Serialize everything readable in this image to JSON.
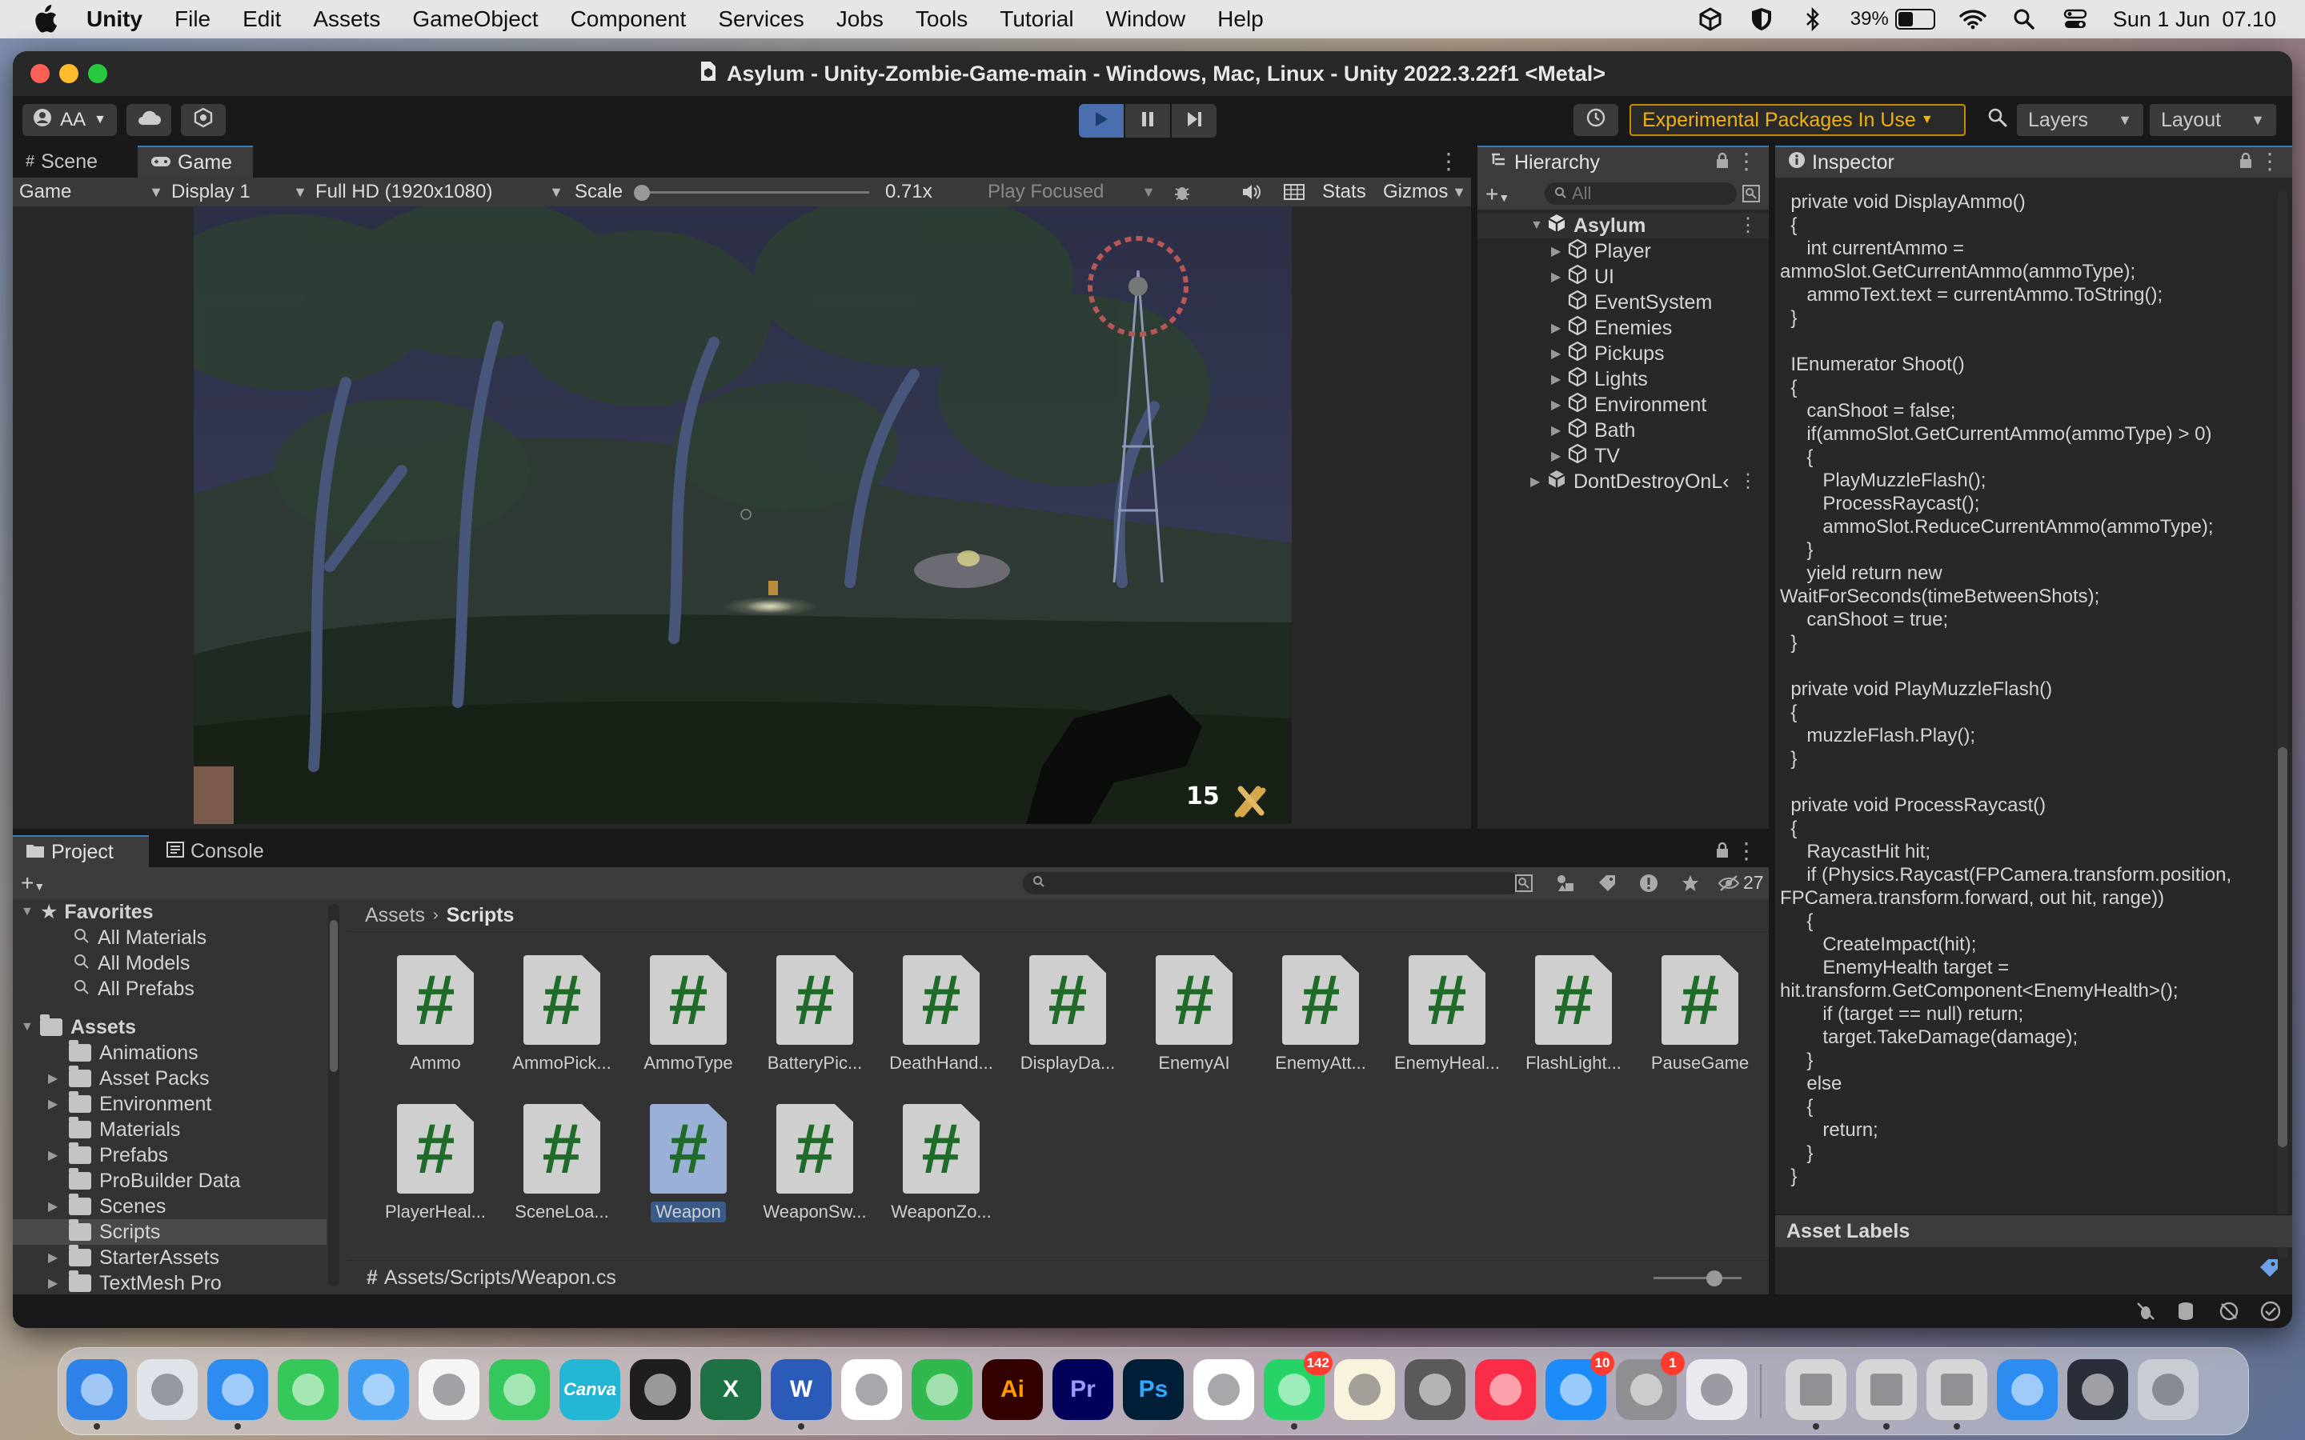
{
  "menubar": {
    "app": "Unity",
    "items": [
      "File",
      "Edit",
      "Assets",
      "GameObject",
      "Component",
      "Services",
      "Jobs",
      "Tools",
      "Tutorial",
      "Window",
      "Help"
    ],
    "battery": "39%",
    "battery_level": 0.39,
    "clock": "Sun 1 Jun  07.10"
  },
  "window": {
    "title": "Asylum - Unity-Zombie-Game-main - Windows, Mac, Linux - Unity 2022.3.22f1 <Metal>"
  },
  "toolbar": {
    "account": "AA",
    "experimental": "Experimental Packages In Use",
    "layers": "Layers",
    "layout": "Layout"
  },
  "scene_panel": {
    "tabs": [
      "Scene",
      "Game"
    ],
    "active_tab": "Game",
    "game_dropdown": "Game",
    "display": "Display 1",
    "resolution": "Full HD (1920x1080)",
    "scale_label": "Scale",
    "scale_value": "0.71x",
    "play_focused": "Play Focused",
    "stats": "Stats",
    "gizmos": "Gizmos",
    "hud_ammo": "15"
  },
  "hierarchy": {
    "tab": "Hierarchy",
    "search_placeholder": "All",
    "root": "Asylum",
    "children": [
      "Player",
      "UI",
      "EventSystem",
      "Enemies",
      "Pickups",
      "Lights",
      "Environment",
      "Bath",
      "TV"
    ],
    "dont_destroy": "DontDestroyOnL‹"
  },
  "inspector": {
    "tab": "Inspector",
    "code_lines": [
      "  private void DisplayAmmo()",
      "  {",
      "     int currentAmmo =",
      "ammoSlot.GetCurrentAmmo(ammoType);",
      "     ammoText.text = currentAmmo.ToString();",
      "  }",
      "",
      "  IEnumerator Shoot()",
      "  {",
      "     canShoot = false;",
      "     if(ammoSlot.GetCurrentAmmo(ammoType) > 0)",
      "     {",
      "        PlayMuzzleFlash();",
      "        ProcessRaycast();",
      "        ammoSlot.ReduceCurrentAmmo(ammoType);",
      "     }",
      "     yield return new",
      "WaitForSeconds(timeBetweenShots);",
      "     canShoot = true;",
      "  }",
      "",
      "  private void PlayMuzzleFlash()",
      "  {",
      "     muzzleFlash.Play();",
      "  }",
      "",
      "  private void ProcessRaycast()",
      "  {",
      "     RaycastHit hit;",
      "     if (Physics.Raycast(FPCamera.transform.position,",
      "FPCamera.transform.forward, out hit, range))",
      "     {",
      "        CreateImpact(hit);",
      "        EnemyHealth target =",
      "hit.transform.GetComponent<EnemyHealth>();",
      "        if (target == null) return;",
      "        target.TakeDamage(damage);",
      "     }",
      "     else",
      "     {",
      "        return;",
      "     }",
      "  }"
    ],
    "asset_labels": "Asset Labels"
  },
  "project": {
    "tabs": [
      "Project",
      "Console"
    ],
    "hidden_count": "27",
    "favorites_label": "Favorites",
    "favorites": [
      "All Materials",
      "All Models",
      "All Prefabs"
    ],
    "assets_label": "Assets",
    "folders": [
      "Animations",
      "Asset Packs",
      "Environment",
      "Materials",
      "Prefabs",
      "ProBuilder Data",
      "Scenes",
      "Scripts",
      "StarterAssets",
      "TextMesh Pro"
    ],
    "selected_folder": "Scripts",
    "breadcrumb": [
      "Assets",
      "Scripts"
    ],
    "scripts": [
      "Ammo",
      "AmmoPick...",
      "AmmoType",
      "BatteryPic...",
      "DeathHand...",
      "DisplayDa...",
      "EnemyAI",
      "EnemyAtt...",
      "EnemyHeal...",
      "FlashLight...",
      "PauseGame",
      "PlayerHeal...",
      "SceneLoa...",
      "Weapon",
      "WeaponSw...",
      "WeaponZo..."
    ],
    "selected_script": "Weapon",
    "path": "Assets/Scripts/Weapon.cs"
  },
  "dock": {
    "apps": [
      {
        "name": "Finder",
        "icon": "finder-icon",
        "color": "#2f83e8"
      },
      {
        "name": "Launchpad",
        "icon": "launchpad-icon",
        "color": "#dfe3ea"
      },
      {
        "name": "Safari",
        "icon": "safari-icon",
        "color": "#2d8cf0"
      },
      {
        "name": "Messages",
        "icon": "messages-icon",
        "color": "#35c759"
      },
      {
        "name": "Mail",
        "icon": "mail-icon",
        "color": "#3d9bf3"
      },
      {
        "name": "Photos",
        "icon": "photos-icon",
        "color": "#f5f5f5"
      },
      {
        "name": "FaceTime",
        "icon": "facetime-icon",
        "color": "#34c759"
      },
      {
        "name": "Canva",
        "icon": "canva-icon",
        "color": "#22b5d4",
        "text": "Canva"
      },
      {
        "name": "Figma",
        "icon": "figma-icon",
        "color": "#1e1e1e"
      },
      {
        "name": "Excel",
        "icon": "excel-icon",
        "color": "#1e7145",
        "text": "X"
      },
      {
        "name": "Word",
        "icon": "word-icon",
        "color": "#2b5bb8",
        "text": "W"
      },
      {
        "name": "VS Code",
        "icon": "vscode-icon",
        "color": "#ffffff"
      },
      {
        "name": "Pen",
        "icon": "pen-icon",
        "color": "#2fb94c"
      },
      {
        "name": "Illustrator",
        "icon": "illustrator-icon",
        "color": "#330000",
        "text": "Ai"
      },
      {
        "name": "Premiere",
        "icon": "premiere-icon",
        "color": "#00005b",
        "text": "Pr"
      },
      {
        "name": "Photoshop",
        "icon": "photoshop-icon",
        "color": "#001e36",
        "text": "Ps"
      },
      {
        "name": "CapCut",
        "icon": "capcut-icon",
        "color": "#ffffff"
      },
      {
        "name": "WhatsApp",
        "icon": "whatsapp-icon",
        "color": "#25d366",
        "badge": "142"
      },
      {
        "name": "Notes",
        "icon": "notes-icon",
        "color": "#f7f3dc"
      },
      {
        "name": "Calculator",
        "icon": "calculator-icon",
        "color": "#5a5a5a"
      },
      {
        "name": "Music",
        "icon": "music-icon",
        "color": "#fa2d48"
      },
      {
        "name": "App Store",
        "icon": "appstore-icon",
        "color": "#1d8cf8",
        "badge": "10"
      },
      {
        "name": "System Settings",
        "icon": "settings-icon",
        "color": "#8e8e93",
        "badge": "1"
      },
      {
        "name": "iPhone Mirroring",
        "icon": "iphone-icon",
        "color": "#e9e9ee"
      },
      {
        "name": "Unity Hub",
        "icon": "unity-hub-icon",
        "color": "#d6d6d6"
      },
      {
        "name": "Unity",
        "icon": "unity-icon",
        "color": "#d6d6d6"
      },
      {
        "name": "Unity 2",
        "icon": "unity-icon",
        "color": "#d6d6d6"
      },
      {
        "name": "Safari 2",
        "icon": "safari-icon",
        "color": "#2d8cf0"
      },
      {
        "name": "Screenshot",
        "icon": "screenshot-icon",
        "color": "#2a2e38"
      },
      {
        "name": "Trash",
        "icon": "trash-icon",
        "color": "#c9ccd2"
      }
    ]
  }
}
